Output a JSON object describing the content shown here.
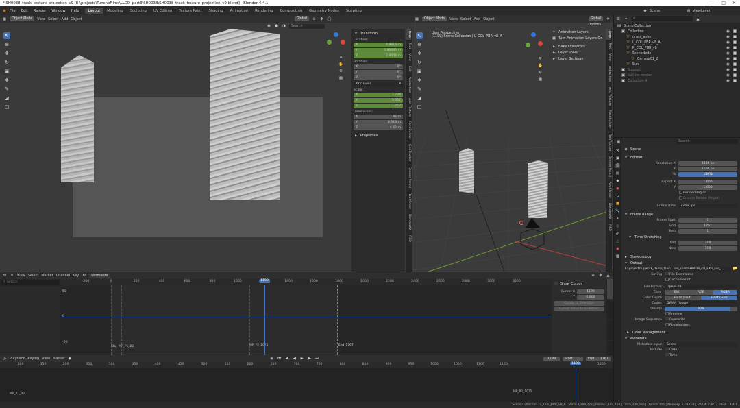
{
  "title": "* SH0038_track_texture_projection_v9 [E:\\projects\\TuncheFilms\\LLDD_part3\\SH0038\\SH0038_track_texture_projection_v9.blend] - Blender 4.4.1",
  "menu": [
    "File",
    "Edit",
    "Render",
    "Window",
    "Help"
  ],
  "workspaces": [
    "Layout",
    "Modeling",
    "Sculpting",
    "UV Editing",
    "Texture Paint",
    "Shading",
    "Animation",
    "Rendering",
    "Compositing",
    "Geometry Nodes",
    "Scripting"
  ],
  "scene": "Scene",
  "view_layer": "ViewLayer",
  "viewport_left": {
    "mode": "Object Mode",
    "menus": [
      "View",
      "Select",
      "Add",
      "Object"
    ],
    "orientation": "Global",
    "search_placeholder": "Search",
    "options": "Options"
  },
  "transform": {
    "header": "Transform",
    "location_label": "Location:",
    "location": {
      "x": "4.8916 m",
      "y": "0.86435 m",
      "z": "2.9444 m"
    },
    "rotation_label": "Rotation:",
    "rotation": {
      "x": "0°",
      "y": "0°",
      "z": "0°"
    },
    "rotation_mode": "XYZ Euler",
    "scale_label": "Scale:",
    "scale": {
      "x": "1.794",
      "y": "3.057",
      "z": "1.252"
    },
    "dimensions_label": "Dimensions:",
    "dimensions": {
      "x": "1.86 m",
      "y": "0.913 m",
      "z": "4.62 m"
    },
    "properties": "Properties"
  },
  "npanel_tabs": [
    "Item",
    "Tool",
    "View",
    "Edit",
    "Animation",
    "Add Texture",
    "FaceBuilder",
    "GeoTracker",
    "Grease Pencil",
    "Real Snow",
    "BlenderKit",
    "RBD"
  ],
  "viewport_right": {
    "mode": "Object Mode",
    "menus": [
      "View",
      "Select",
      "Add",
      "Object"
    ],
    "orientation": "Global",
    "options": "Options",
    "overlay_title": "User Perspective",
    "overlay_sub": "(1199) Scene Collection | L_COL_PBR_v8_A"
  },
  "anim_layers": {
    "header": "Animation Layers",
    "toggle": "Turn Animation Layers On",
    "items": [
      "Bake Operators",
      "Layer Tools",
      "Layer Settings"
    ]
  },
  "npanel_tabs_right": [
    "Item",
    "Tool",
    "View",
    "Animation",
    "Add Texture",
    "FaceBuilder",
    "GeoTracker",
    "Grease Pencil",
    "Real Snow",
    "BlenderKit",
    "RBD"
  ],
  "outliner": {
    "root": "Scene Collection",
    "items": [
      {
        "name": "Collection",
        "indent": 0
      },
      {
        "name": "grass_anim",
        "indent": 1
      },
      {
        "name": "L_COL_PBR_v8_A",
        "indent": 1
      },
      {
        "name": "R_COL_PBR_v8",
        "indent": 1
      },
      {
        "name": "SceneNode",
        "indent": 1
      },
      {
        "name": "Camera01_2",
        "indent": 2
      },
      {
        "name": "Sun",
        "indent": 1
      },
      {
        "name": "Support",
        "indent": 0
      },
      {
        "name": "ball_no_render",
        "indent": 0
      },
      {
        "name": "Collection 4",
        "indent": 0
      }
    ]
  },
  "graph_editor": {
    "menus": [
      "View",
      "Select",
      "Marker",
      "Channel",
      "Key"
    ],
    "normalize": "Normalize",
    "ticks": [
      "-200",
      "0",
      "200",
      "400",
      "600",
      "800",
      "1000",
      "1200",
      "1400",
      "1600",
      "1800",
      "2000",
      "2200",
      "2400",
      "2600",
      "2800",
      "3000",
      "3200"
    ],
    "current_frame": "1199",
    "y_labels": [
      "50",
      "0",
      "-50"
    ],
    "markers": [
      "Sta",
      "MP_P1_B2",
      "MP_P2_1075",
      "End_1767"
    ],
    "show_cursor": "Show Cursor",
    "cursor_x_label": "Cursor X",
    "cursor_x": "1199",
    "cursor_y_label": "Y",
    "cursor_y": "0.000",
    "cursor_to_selection": "Cursor to Selection",
    "cursor_value_to_selection": "Cursor Value to Selection"
  },
  "timeline": {
    "menus": [
      "Playback",
      "Keying",
      "View",
      "Marker"
    ],
    "frame": "1199",
    "start_label": "Start",
    "start": "1",
    "end_label": "End",
    "end": "1767",
    "ticks": [
      "100",
      "150",
      "200",
      "250",
      "300",
      "350",
      "400",
      "450",
      "500",
      "550",
      "600",
      "650",
      "700",
      "750",
      "800",
      "850",
      "900",
      "950",
      "1000",
      "1050",
      "1100",
      "1150",
      "1199",
      "1250"
    ],
    "markers": [
      "MP_P1_B2",
      "MP_P2_1075"
    ]
  },
  "statusbar": "Scene Collection | L_COL_PBR_v8_A | Verts:3,104,772 | Faces:3,104,768 | Tris:6,209,536 | Objects:0/5 | Memory: 5.09 GiB | VRAM: 7.6/12.0 GiB | 4.4.1",
  "properties": {
    "search_placeholder": "Search",
    "scene_label": "Scene",
    "format": {
      "header": "Format",
      "res_x_label": "Resolution X",
      "res_x": "3840 px",
      "res_y_label": "Y",
      "res_y": "2160 px",
      "pct_label": "%",
      "pct": "100%",
      "aspect_x_label": "Aspect X",
      "aspect_x": "1.000",
      "aspect_y_label": "Y",
      "aspect_y": "1.000",
      "render_region": "Render Region",
      "crop": "Crop to Render Region",
      "frame_rate_label": "Frame Rate",
      "frame_rate": "23.98 fps"
    },
    "frame_range": {
      "header": "Frame Range",
      "start_label": "Frame Start",
      "start": "1",
      "end_label": "End",
      "end": "1767",
      "step_label": "Step",
      "step": "1",
      "time_stretching": "Time Stretching",
      "old_label": "Old",
      "old": "100",
      "new_label": "New",
      "new": "100"
    },
    "stereoscopy": "Stereoscopy",
    "output": {
      "header": "Output",
      "path": "E:\\projects\\upwork_demo_files\\...seq_solid\\SH0038_col_EXR_seq_",
      "saving_label": "Saving",
      "file_ext": "File Extensions",
      "cache_result": "Cache Result",
      "file_format_label": "File Format",
      "file_format": "OpenEXR",
      "color_label": "Color",
      "color_opts": [
        "BW",
        "RGB",
        "RGBA"
      ],
      "depth_label": "Color Depth",
      "depth_opts": [
        "Float (Half)",
        "Float (Full)"
      ],
      "codec_label": "Codec",
      "codec": "DWAA (lossy)",
      "quality_label": "Quality",
      "quality": "90%",
      "preview": "Preview",
      "image_seq_label": "Image Sequence",
      "overwrite": "Overwrite",
      "placeholders": "Placeholders",
      "color_mgmt": "Color Management"
    },
    "metadata": {
      "header": "Metadata",
      "input_label": "Metadata Input",
      "input": "Scene",
      "include_label": "Include",
      "date": "Date",
      "time": "Time"
    }
  }
}
